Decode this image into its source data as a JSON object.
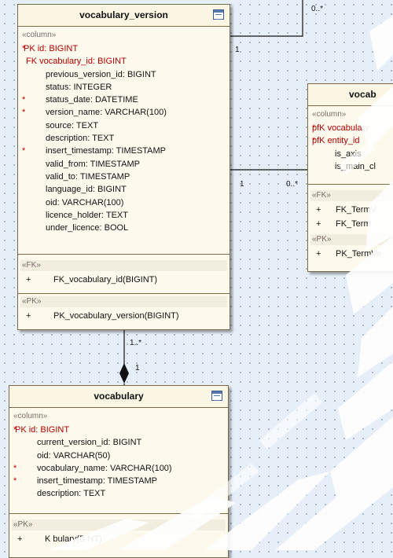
{
  "colors": {
    "background": "#e6eef8",
    "box_fill": "#fdf9ec",
    "box_border": "#7a6a4a",
    "key_text": "#b00000",
    "marker": "#c00000"
  },
  "vocabulary_version": {
    "title": "vocabulary_version",
    "column_stereo": "«column»",
    "columns": [
      {
        "marker": "*",
        "text": "PK id:  BIGINT",
        "key": true
      },
      {
        "marker": "",
        "text": "FK  vocabulary_id:  BIGINT",
        "key": true
      },
      {
        "marker": "",
        "text": "previous_version_id:  BIGINT",
        "key": false
      },
      {
        "marker": "",
        "text": "status:  INTEGER",
        "key": false
      },
      {
        "marker": "*",
        "text": "status_date:  DATETIME",
        "key": false
      },
      {
        "marker": "*",
        "text": "version_name:  VARCHAR(100)",
        "key": false
      },
      {
        "marker": "",
        "text": "source:  TEXT",
        "key": false
      },
      {
        "marker": "",
        "text": "description:  TEXT",
        "key": false
      },
      {
        "marker": "*",
        "text": "insert_timestamp:  TIMESTAMP",
        "key": false
      },
      {
        "marker": "",
        "text": "valid_from:  TIMESTAMP",
        "key": false
      },
      {
        "marker": "",
        "text": "valid_to:  TIMESTAMP",
        "key": false
      },
      {
        "marker": "",
        "text": "language_id:  BIGINT",
        "key": false
      },
      {
        "marker": "",
        "text": "oid:  VARCHAR(100)",
        "key": false
      },
      {
        "marker": "",
        "text": "licence_holder:  TEXT",
        "key": false
      },
      {
        "marker": "",
        "text": "under_licence:  BOOL",
        "key": false
      }
    ],
    "fk_stereo": "«FK»",
    "fk_ops": [
      {
        "plus": "+",
        "text": "FK_vocabulary_id(BIGINT)"
      }
    ],
    "pk_stereo": "«PK»",
    "pk_ops": [
      {
        "plus": "+",
        "text": "PK_vocabulary_version(BIGINT)"
      }
    ]
  },
  "vocabulary": {
    "title": "vocabulary",
    "column_stereo": "«column»",
    "columns": [
      {
        "marker": "*",
        "text": "PK id:  BIGINT",
        "key": true
      },
      {
        "marker": "",
        "text": "current_version_id:  BIGINT",
        "key": false
      },
      {
        "marker": "",
        "text": "oid:  VARCHAR(50)",
        "key": false
      },
      {
        "marker": "*",
        "text": "vocabulary_name:  VARCHAR(100)",
        "key": false
      },
      {
        "marker": "*",
        "text": "insert_timestamp:  TIMESTAMP",
        "key": false
      },
      {
        "marker": "",
        "text": "description:  TEXT",
        "key": false
      }
    ],
    "pk_stereo": "«PK»",
    "pk_ops": [
      {
        "plus": "+",
        "text": "K   bulary(B    NT)"
      }
    ]
  },
  "term_version": {
    "title": "vocab",
    "column_stereo": "«column»",
    "columns": [
      {
        "marker": "*",
        "text": "pfK vocabulary",
        "key": true
      },
      {
        "marker": "*",
        "text": "pfK entity_id",
        "key": true
      },
      {
        "marker": "",
        "text": "is_axis",
        "key": false
      },
      {
        "marker": "",
        "text": "is_main_cl",
        "key": false
      }
    ],
    "fk_stereo": "«FK»",
    "fk_ops": [
      {
        "plus": "+",
        "text": "FK_TermV"
      },
      {
        "plus": "+",
        "text": "FK_Term"
      }
    ],
    "pk_stereo": "«PK»",
    "pk_ops": [
      {
        "plus": "+",
        "text": "PK_TermVe"
      }
    ]
  },
  "multiplicities": {
    "top_right": "0..*",
    "top_one": "1",
    "mid_one": "1",
    "mid_many": "0..*",
    "bottom_many": "1..*",
    "bottom_one": "1"
  }
}
